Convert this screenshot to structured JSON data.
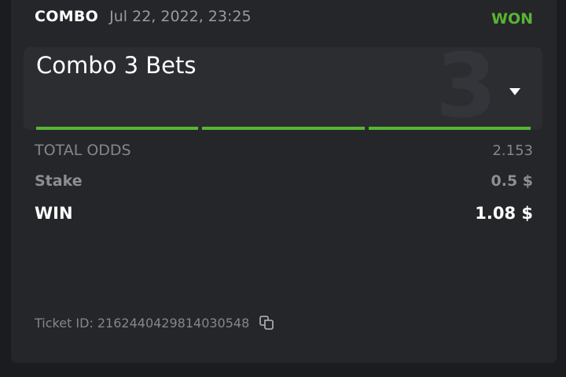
{
  "header": {
    "bet_type": "COMBO",
    "date": "Jul 22, 2022, 23:25",
    "status": "WON"
  },
  "combo": {
    "title": "Combo 3 Bets",
    "watermark_count": "3",
    "legs_completed": 3,
    "legs_total": 3,
    "toggle_icon": "chevron-down-icon"
  },
  "summary": {
    "total_odds_label": "TOTAL ODDS",
    "total_odds_value": "2.153",
    "stake_label": "Stake",
    "stake_value": "0.5 $",
    "win_label": "WIN",
    "win_value": "1.08 $"
  },
  "ticket": {
    "label": "Ticket ID:",
    "id": "2162440429814030548",
    "copy_icon": "copy-icon"
  },
  "colors": {
    "accent_green": "#57b533",
    "card_background": "#252629",
    "page_background": "#1b1c20",
    "muted_text": "#85868b"
  }
}
